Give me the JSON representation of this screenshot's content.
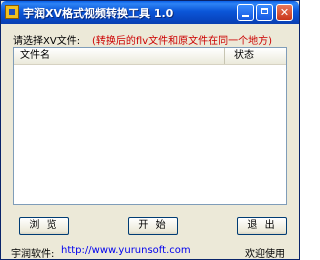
{
  "window": {
    "title": "宇润XV格式视频转换工具 1.0",
    "controls": {
      "minimize": "",
      "maximize": "",
      "close": "✕"
    }
  },
  "prompt": {
    "label": "请选择XV文件:",
    "note": "(转换后的flv文件和原文件在同一个地方)"
  },
  "file_list": {
    "columns": [
      "文件名",
      "状态"
    ],
    "rows": []
  },
  "buttons": {
    "browse": "浏 览",
    "start": "开 始",
    "exit": "退 出"
  },
  "footer": {
    "label": "宇润软件:",
    "url": "http://www.yurunsoft.com",
    "note": "欢迎使用"
  }
}
